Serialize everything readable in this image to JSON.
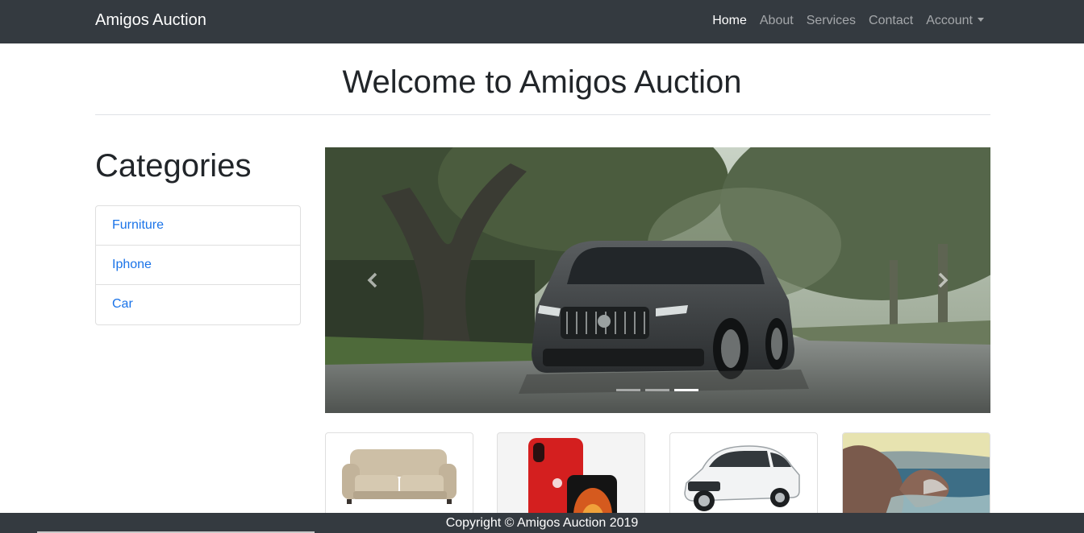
{
  "navbar": {
    "brand": "Amigos Auction",
    "links": [
      {
        "label": "Home",
        "active": true
      },
      {
        "label": "About",
        "active": false
      },
      {
        "label": "Services",
        "active": false
      },
      {
        "label": "Contact",
        "active": false
      },
      {
        "label": "Account",
        "active": false,
        "dropdown": true
      }
    ]
  },
  "page": {
    "title": "Welcome to Amigos Auction"
  },
  "categories": {
    "heading": "Categories",
    "items": [
      {
        "label": "Furniture"
      },
      {
        "label": "Iphone"
      },
      {
        "label": "Car"
      }
    ]
  },
  "carousel": {
    "slide_image": "car-on-tree-lined-road",
    "prev_icon": "chevron-left-icon",
    "next_icon": "chevron-right-icon",
    "indicators": 3,
    "active_indicator": 3
  },
  "thumbnails": [
    {
      "image": "sofa"
    },
    {
      "image": "red-iphone"
    },
    {
      "image": "white-car"
    },
    {
      "image": "seascape-painting"
    }
  ],
  "footer": {
    "copyright": "Copyright © Amigos Auction 2019"
  },
  "colors": {
    "navbar_bg": "#343a40",
    "link": "#1a73e8",
    "border": "#dfdfdf"
  }
}
